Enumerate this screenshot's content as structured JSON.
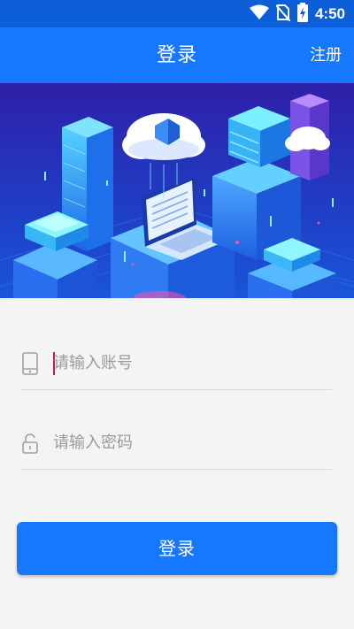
{
  "status_bar": {
    "time": "4:50",
    "icons": [
      "wifi-icon",
      "no-sim-icon",
      "battery-charging-icon"
    ]
  },
  "app_bar": {
    "title": "登录",
    "register_label": "注册"
  },
  "banner": {
    "description_icon": "cloud-server-illustration"
  },
  "form": {
    "account_placeholder": "请输入账号",
    "account_value": "",
    "account_icon": "phone-icon",
    "password_placeholder": "请输入密码",
    "password_value": "",
    "password_icon": "lock-icon",
    "login_label": "登录"
  },
  "colors": {
    "primary": "#1677ff",
    "status_bar": "#0d5fd9",
    "background": "#f4f4f4",
    "divider": "#d9d9d9",
    "placeholder": "#9a9a9a"
  }
}
